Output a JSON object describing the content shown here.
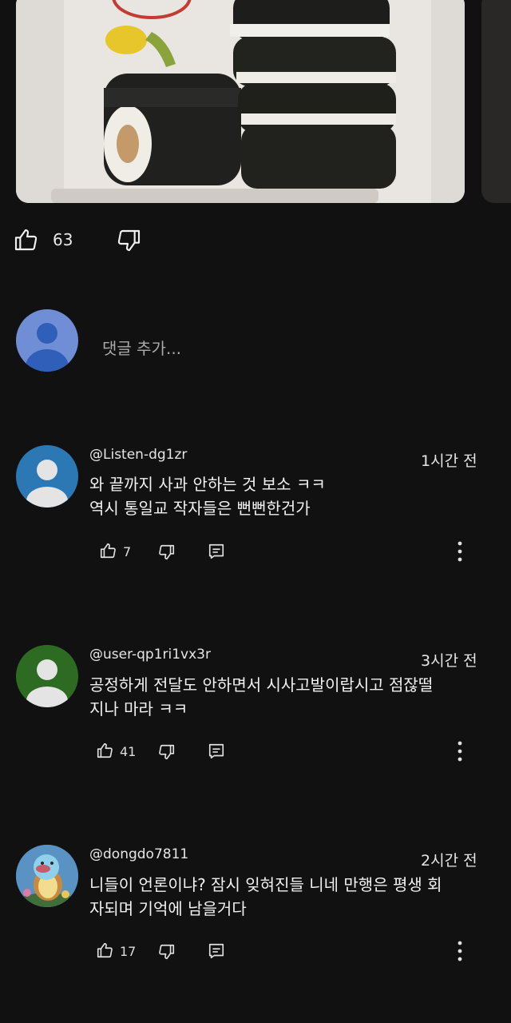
{
  "post": {
    "likes": "63"
  },
  "add_comment": {
    "placeholder": "댓글 추가..."
  },
  "comments": [
    {
      "author": "@Listen-dg1zr",
      "time": "1시간 전",
      "line1": "와 끝까지 사과 안하는 것 보소 ㅋㅋ",
      "line2": "역시 통일교 작자들은 뻔뻔한건가",
      "likes": "7",
      "avatar_color": "#2b78b5"
    },
    {
      "author": "@user-qp1ri1vx3r",
      "time": "3시간 전",
      "line1": "공정하게 전달도 안하면서 시사고발이랍시고 점잖떨",
      "line2": "지나 마라 ㅋㅋ",
      "likes": "41",
      "avatar_color": "#2e6b22"
    },
    {
      "author": "@dongdo7811",
      "time": "2시간 전",
      "line1": "니들이 언론이냐? 잠시 잊혀진들 니네 만행은 평생 회",
      "line2": "자되며 기억에 남을거다",
      "likes": "17",
      "avatar_color": "#4d86b8"
    }
  ],
  "icons": [
    "like-icon",
    "dislike-icon",
    "reply-icon",
    "more-vertical-icon",
    "person-icon"
  ]
}
